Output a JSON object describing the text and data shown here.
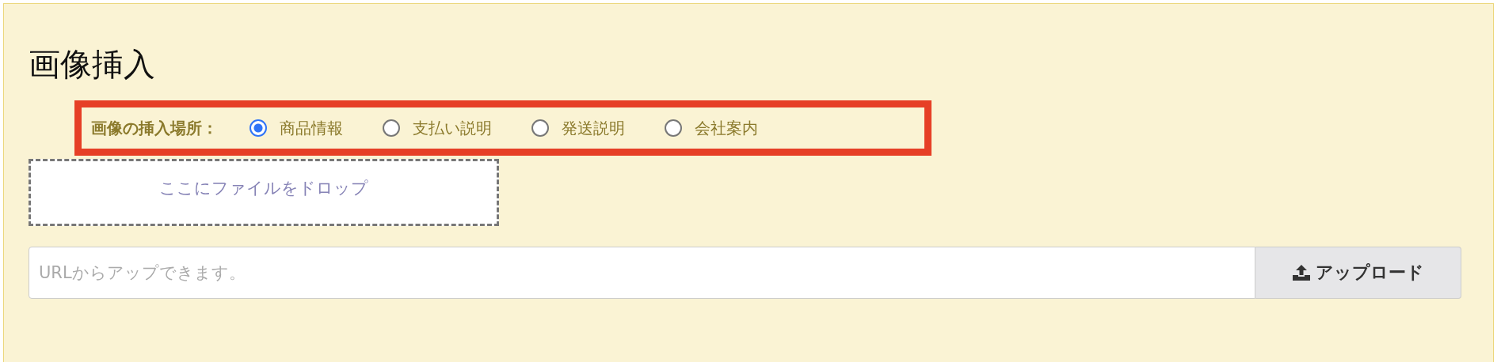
{
  "title": "画像挿入",
  "placement": {
    "label": "画像の挿入場所：",
    "options": [
      {
        "label": "商品情報",
        "selected": true
      },
      {
        "label": "支払い説明",
        "selected": false
      },
      {
        "label": "発送説明",
        "selected": false
      },
      {
        "label": "会社案内",
        "selected": false
      }
    ]
  },
  "drop_zone": {
    "text": "ここにファイルをドロップ"
  },
  "url_field": {
    "placeholder": "URLからアップできます。"
  },
  "upload_button": {
    "label": "アップロード"
  }
}
